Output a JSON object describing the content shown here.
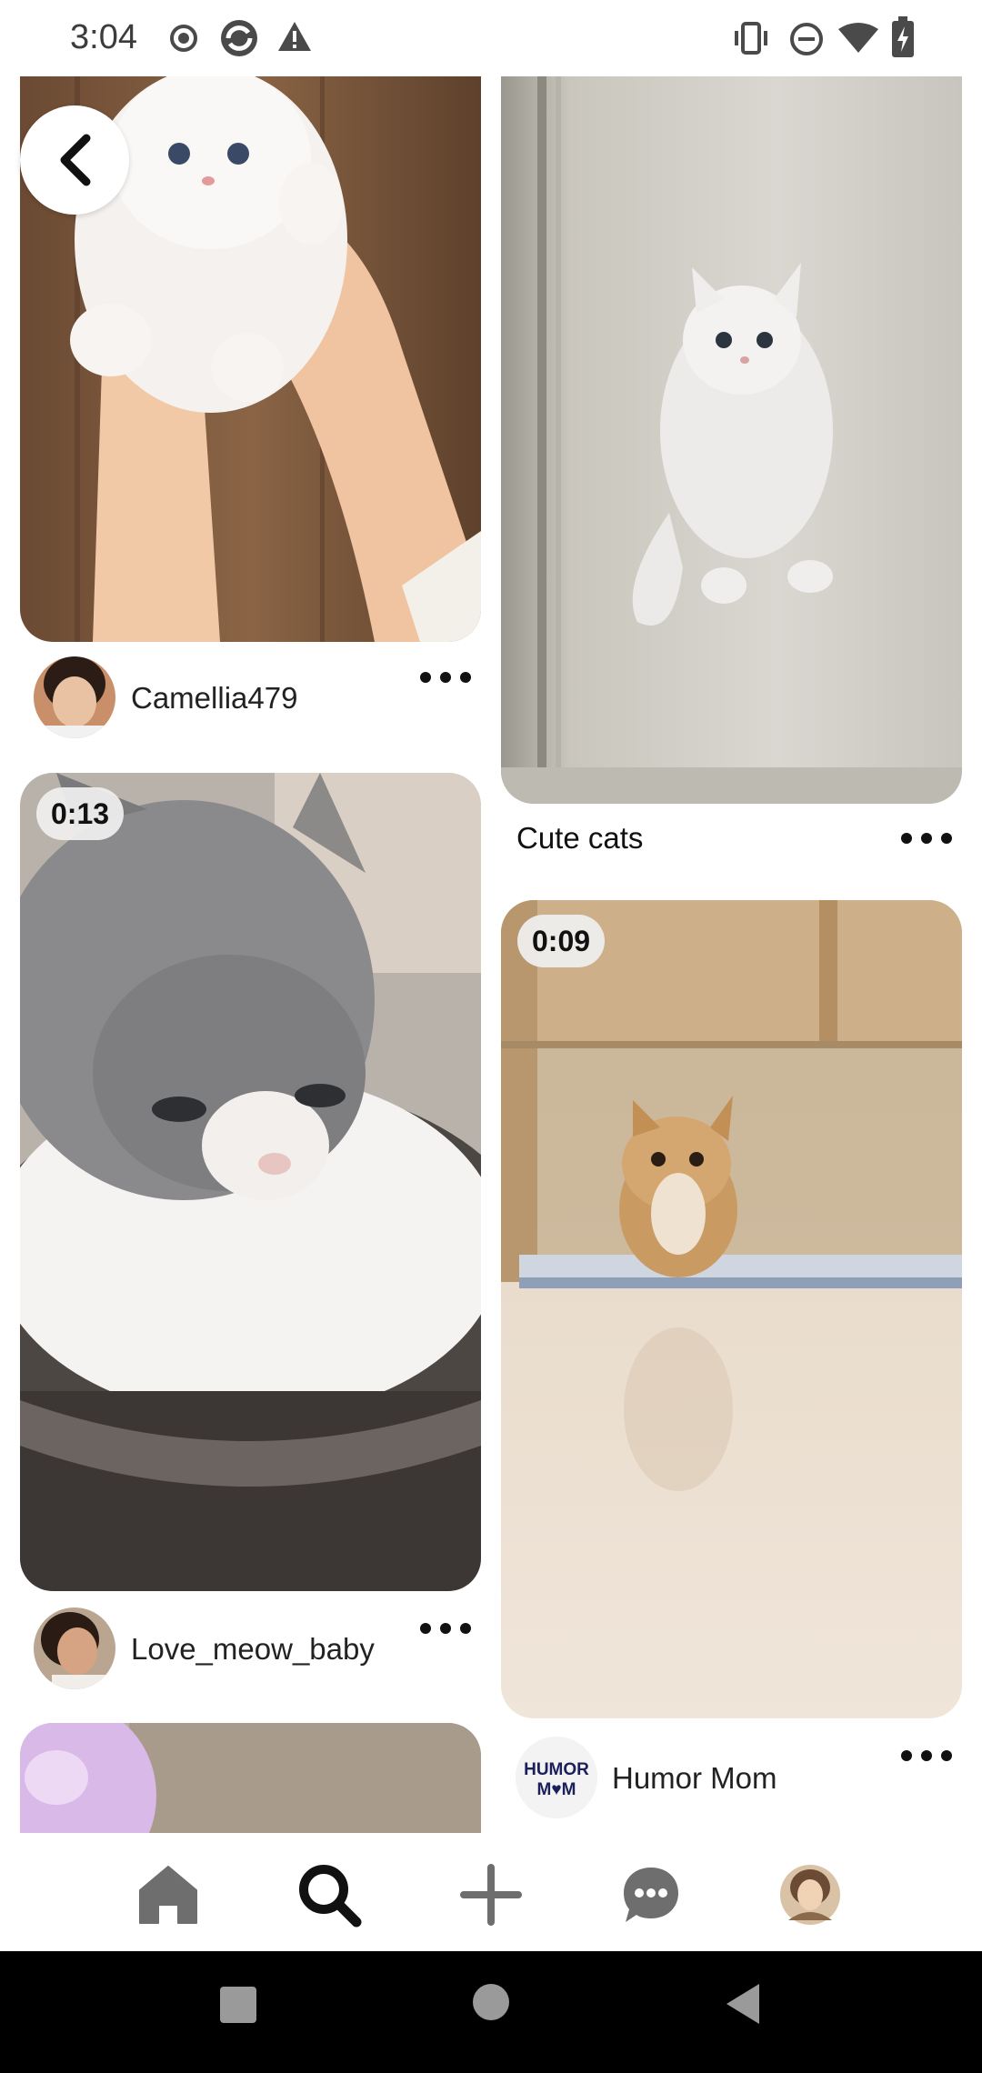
{
  "status_bar": {
    "time": "3:04"
  },
  "navigation": {
    "back_label": "Back"
  },
  "pins": {
    "camellia": {
      "author": "Camellia479"
    },
    "cute_cats": {
      "title": "Cute cats"
    },
    "milk_kitten": {
      "duration": "0:13",
      "author": "Love_meow_baby"
    },
    "floor_kitten": {
      "duration": "0:09",
      "author": "Humor Mom",
      "author_logo_text": [
        "HUMOR",
        "MOM"
      ]
    }
  },
  "bottom_nav": {
    "items": [
      {
        "name": "home",
        "icon": "home-icon"
      },
      {
        "name": "search",
        "icon": "search-icon",
        "active": true
      },
      {
        "name": "create",
        "icon": "plus-icon"
      },
      {
        "name": "messages",
        "icon": "chat-bubble-icon"
      },
      {
        "name": "profile",
        "icon": "avatar"
      }
    ]
  },
  "colors": {
    "background": "#ffffff",
    "icon_dark": "#111111",
    "icon_gray": "#6e6e6e"
  }
}
